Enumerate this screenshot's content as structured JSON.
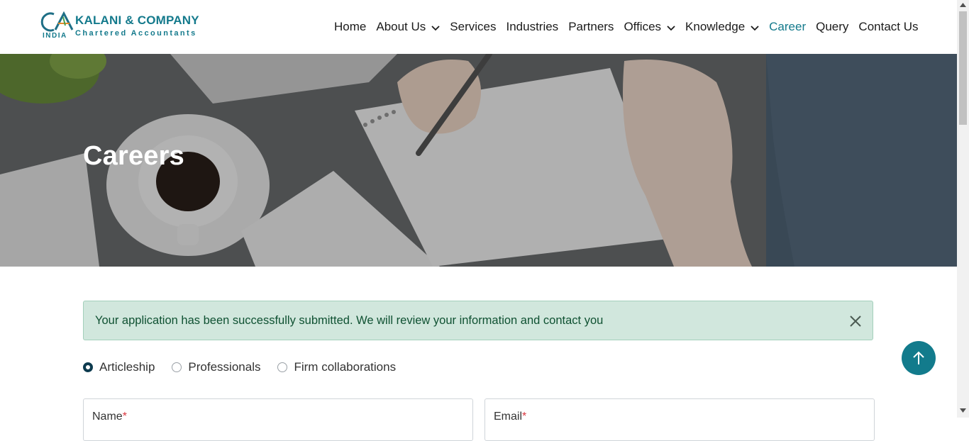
{
  "logo": {
    "name": "KALANI & COMPANY",
    "subtitle": "Chartered Accountants",
    "country": "INDIA",
    "mark": "CA"
  },
  "nav": {
    "items": [
      {
        "label": "Home"
      },
      {
        "label": "About Us"
      },
      {
        "label": "Services"
      },
      {
        "label": "Industries"
      },
      {
        "label": "Partners"
      },
      {
        "label": "Offices"
      },
      {
        "label": "Knowledge"
      },
      {
        "label": "Career"
      },
      {
        "label": "Query"
      },
      {
        "label": "Contact Us"
      }
    ],
    "active": "Career"
  },
  "hero": {
    "title": "Careers"
  },
  "alert": {
    "message": "Your application has been successfully submitted. We will review your information and contact you"
  },
  "application_type": {
    "options": [
      "Articleship",
      "Professionals",
      "Firm collaborations"
    ],
    "selected": "Articleship"
  },
  "form": {
    "name_label": "Name",
    "email_label": "Email",
    "required_mark": "*"
  },
  "icons": {
    "dropdown": "chevron-down-icon",
    "close": "close-icon",
    "back_to_top": "arrow-up-icon"
  },
  "colors": {
    "brand": "#147a8c",
    "alert_bg": "#d1e7dd",
    "alert_text": "#0f5132",
    "back_to_top": "#127b8c"
  }
}
